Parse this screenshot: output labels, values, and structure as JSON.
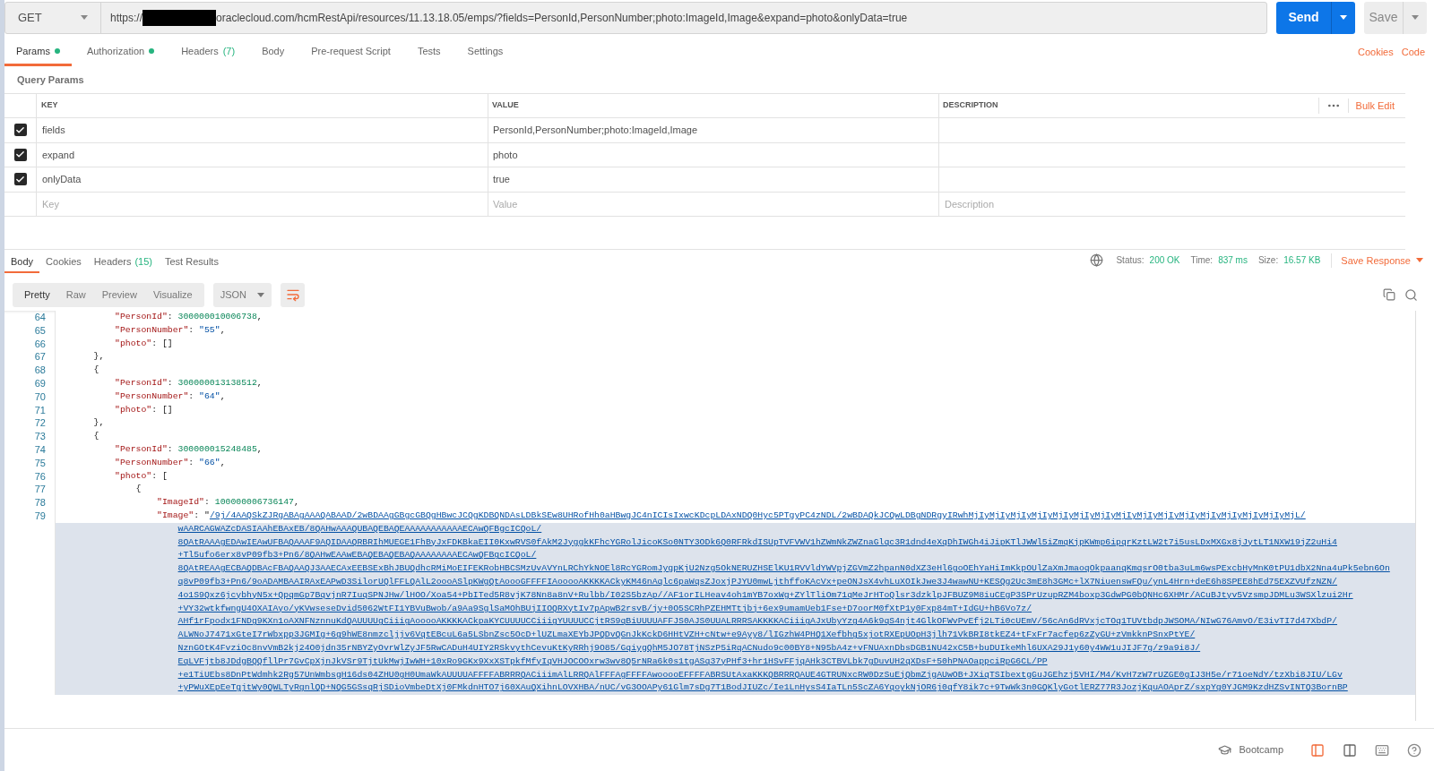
{
  "request": {
    "method": "GET",
    "url_start": "https://",
    "url_end": "oraclecloud.com/hcmRestApi/resources/11.13.18.05/emps/?fields=PersonId,PersonNumber;photo:ImageId,Image&expand=photo&onlyData=true",
    "send": "Send",
    "save": "Save"
  },
  "request_tabs": [
    {
      "label": "Params",
      "dot": true,
      "selected": true
    },
    {
      "label": "Authorization",
      "dot": true,
      "selected": false
    },
    {
      "label": "Headers",
      "count": "(7)",
      "dot": false,
      "selected": false
    },
    {
      "label": "Body",
      "dot": false,
      "selected": false
    },
    {
      "label": "Pre-request Script",
      "dot": false,
      "selected": false
    },
    {
      "label": "Tests",
      "dot": false,
      "selected": false
    },
    {
      "label": "Settings",
      "dot": false,
      "selected": false
    }
  ],
  "request_links": [
    "Cookies",
    "Code"
  ],
  "params": {
    "title": "Query Params",
    "columns": [
      "KEY",
      "VALUE",
      "DESCRIPTION"
    ],
    "bulk_edit": "Bulk Edit",
    "rows": [
      {
        "key": "fields",
        "value": "PersonId,PersonNumber;photo:ImageId,Image",
        "checked": true
      },
      {
        "key": "expand",
        "value": "photo",
        "checked": true
      },
      {
        "key": "onlyData",
        "value": "true",
        "checked": true
      }
    ],
    "new_row": {
      "key_placeholder": "Key",
      "value_placeholder": "Value",
      "description_placeholder": "Description"
    }
  },
  "response_tabs": [
    {
      "label": "Body",
      "selected": true
    },
    {
      "label": "Cookies",
      "selected": false
    },
    {
      "label": "Headers",
      "count": "(15)",
      "selected": false
    },
    {
      "label": "Test Results",
      "selected": false
    }
  ],
  "status": {
    "status_label": "Status:",
    "status": "200 OK",
    "time_label": "Time:",
    "time": "837 ms",
    "size_label": "Size:",
    "size": "16.57 KB",
    "save_response": "Save Response"
  },
  "view_modes": [
    {
      "label": "Pretty",
      "selected": true
    },
    {
      "label": "Raw",
      "selected": false
    },
    {
      "label": "Preview",
      "selected": false
    },
    {
      "label": "Visualize",
      "selected": false
    }
  ],
  "format": "JSON",
  "wrap_lines": true,
  "code_lines": [
    {
      "children": [
        {
          "number": "64",
          "selected": false,
          "tokens": [
            {
              "kind": "key",
              "text": "\"PersonId\""
            },
            {
              "kind": "punct",
              "text": ": "
            },
            {
              "kind": "number",
              "text": "300000010006738"
            },
            {
              "kind": "punct",
              "text": ","
            }
          ]
        },
        {
          "number": "65",
          "selected": false,
          "tokens": [
            {
              "kind": "key",
              "text": "\"PersonNumber\""
            },
            {
              "kind": "punct",
              "text": ": "
            },
            {
              "kind": "string",
              "text": "\"55\""
            },
            {
              "kind": "punct",
              "text": ","
            }
          ]
        },
        {
          "number": "66",
          "selected": false,
          "tokens": [
            {
              "kind": "key",
              "text": "\"photo\""
            },
            {
              "kind": "punct",
              "text": ": []"
            }
          ]
        }
      ]
    },
    {
      "number": "67",
      "selected": false,
      "tokens": [
        {
          "kind": "punct",
          "text": "},"
        }
      ]
    },
    {
      "number": "68",
      "selected": false,
      "tokens": [
        {
          "kind": "punct",
          "text": "{"
        }
      ],
      "children": [
        {
          "number": "69",
          "selected": false,
          "tokens": [
            {
              "kind": "key",
              "text": "\"PersonId\""
            },
            {
              "kind": "punct",
              "text": ": "
            },
            {
              "kind": "number",
              "text": "300000013138512"
            },
            {
              "kind": "punct",
              "text": ","
            }
          ]
        },
        {
          "number": "70",
          "selected": false,
          "tokens": [
            {
              "kind": "key",
              "text": "\"PersonNumber\""
            },
            {
              "kind": "punct",
              "text": ": "
            },
            {
              "kind": "string",
              "text": "\"64\""
            },
            {
              "kind": "punct",
              "text": ","
            }
          ]
        },
        {
          "number": "71",
          "selected": false,
          "tokens": [
            {
              "kind": "key",
              "text": "\"photo\""
            },
            {
              "kind": "punct",
              "text": ": []"
            }
          ]
        }
      ]
    },
    {
      "number": "72",
      "selected": false,
      "tokens": [
        {
          "kind": "punct",
          "text": "},"
        }
      ]
    },
    {
      "number": "73",
      "selected": false,
      "tokens": [
        {
          "kind": "punct",
          "text": "{"
        }
      ],
      "children": [
        {
          "number": "74",
          "selected": false,
          "tokens": [
            {
              "kind": "key",
              "text": "\"PersonId\""
            },
            {
              "kind": "punct",
              "text": ": "
            },
            {
              "kind": "number",
              "text": "300000015248485"
            },
            {
              "kind": "punct",
              "text": ","
            }
          ]
        },
        {
          "number": "75",
          "selected": false,
          "tokens": [
            {
              "kind": "key",
              "text": "\"PersonNumber\""
            },
            {
              "kind": "punct",
              "text": ": "
            },
            {
              "kind": "string",
              "text": "\"66\""
            },
            {
              "kind": "punct",
              "text": ","
            }
          ]
        },
        {
          "number": "76",
          "selected": false,
          "tokens": [
            {
              "kind": "key",
              "text": "\"photo\""
            },
            {
              "kind": "punct",
              "text": ": ["
            }
          ],
          "children": [
            {
              "number": "77",
              "selected": false,
              "tokens": [
                {
                  "kind": "punct",
                  "text": "{"
                }
              ],
              "children": [
                {
                  "number": "78",
                  "selected": false,
                  "tokens": [
                    {
                      "kind": "key",
                      "text": "\"ImageId\""
                    },
                    {
                      "kind": "punct",
                      "text": ": "
                    },
                    {
                      "kind": "number",
                      "text": "100000006736147"
                    },
                    {
                      "kind": "punct",
                      "text": ","
                    }
                  ]
                },
                {
                  "number": "79",
                  "selected": false,
                  "tokens": [
                    {
                      "kind": "key",
                      "text": "\"Image\""
                    },
                    {
                      "kind": "punct",
                      "text": ": \""
                    },
                    {
                      "kind": "link",
                      "text": "/9j/4AAQSkZJRgABAgAAAQABAAD/2wBDAAgGBgcGBQgHBwcJCQgKDBQNDAsLDBkSEw8UHRofHh0aHBwgJC4nICIsIxwcKDcpLDAxNDQ0Hyc5PTgyPC4zNDL/2wBDAQkJCQwLDBgNDRgyIRwhMjIyMjIyMjIyMjIyMjIyMjIyMjIyMjIyMjIyMjIyMjIyMjIyMjIyMjIyMjIyMjL/"
                    }
                  ],
                  "children": [
                    {
                      "selected": true,
                      "tokens": [
                        {
                          "kind": "link",
                          "text": "wAARCAGWAZcDASIAAhEBAxEB/8QAHwAAAQUBAQEBAQEAAAAAAAAAAAECAwQFBgcICQoL/"
                        }
                      ]
                    },
                    {
                      "selected": true,
                      "tokens": [
                        {
                          "kind": "link",
                          "text": "8QAtRAAAgEDAwIEAwUFBAQAAAF9AQIDAAQRBRIhMUEGE1FhByJxFDKBkaEII0KxwRVS0fAkM2JyggkKFhcYGRolJicoKSo0NTY3ODk6Q0RFRkdISUpTVFVWV1hZWmNkZWZnaGlqc3R1dnd4eXqDhIWGh4iJipKTlJWWl5iZmqKjpKWmp6ipqrKztLW2t7i5usLDxMXGx8jJytLT1NXW19jZ2uHi4"
                        }
                      ]
                    },
                    {
                      "selected": true,
                      "tokens": [
                        {
                          "kind": "link",
                          "text": "+Tl5ufo6erx8vP09fb3+Pn6/8QAHwEAAwEBAQEBAQEBAQAAAAAAAAECAwQFBgcICQoL/"
                        }
                      ]
                    },
                    {
                      "selected": true,
                      "tokens": [
                        {
                          "kind": "link",
                          "text": "8QAtREAAgECBAQDBAcFBAQAAQJ3AAECAxEEBSExBhJBUQdhcRMiMoEIFEKRobHBCSMzUvAVYnLRChYkNOEl8RcYGRomJygpKjU2Nzg5OkNERUZHSElKU1RVVldYWVpjZGVmZ2hpanN0dXZ3eHl6goOEhYaHiImKkpOUlZaXmJmaoqOkpaanqKmqsrO0tba3uLm6wsPExcbHyMnK0tPU1dbX2Nna4uPk5ebn6On"
                        }
                      ]
                    },
                    {
                      "selected": true,
                      "tokens": [
                        {
                          "kind": "link",
                          "text": "q8vP09fb3+Pn6/9oADAMBAAIRAxEAPwD3SilorUQlFFLQAlL2oooASlpKWgQtAoooGFFFFIAooooAKKKKACkyKM46nAqlc6paWqsZJoxjPJYU0mwLjthffoKAcVx+peONJsX4vhLuXOIkJwe3J4wawNU+KESQg2Uc3mE8h3GMc+lX7NiuenswFQu/ynL4Hrn+deE6h8SPEE8hEd75EXZVUfzNZN/"
                        }
                      ]
                    },
                    {
                      "selected": true,
                      "tokens": [
                        {
                          "kind": "link",
                          "text": "4o1S9Qxz6jcybhyN5x+QpqmGp7BqvjnR7IuqSPNJHw/lHOO/Xoa54+PbITed5R8vjK78Nn8a8nV+Rulbb/I02S5bzAp//AF1orILHeav4oh1mYB7oxWg+ZYlTliOm71qMeJrHToQlsr3dzklpJFBUZ9M8iuCEgP3SPrUzupRZM4boxp3GdwPG0bQNHc6XHMr/ACuBJtyv5VzsmpJDMLu3WSXlzui2Hr"
                        }
                      ]
                    },
                    {
                      "selected": true,
                      "tokens": [
                        {
                          "kind": "link",
                          "text": "+VY32wtkfwngU4OXAIAyo/yKVwseseDvid5062WtFI1YBVuBwob/a9Aa9SglSaMOhBUjIIOQRXytIv7pApwB2rsvB/jy+0O5SCRhPZEHMTtjbj+6ex9umamUeb1Fse+D7oorM0fXtP1y0Fxp84mT+IdGU+hB6Vo7z/"
                        }
                      ]
                    },
                    {
                      "selected": true,
                      "tokens": [
                        {
                          "kind": "link",
                          "text": "AHf1rFpodx1FNDg9KXn1oAXNFNznnuKdQAUUUUgCiiigAooooAKKKKACkpaKYCUUUUCCiiigYUUUUCCjtRS9qBiUUUUAFFJS0AJS0UUALRRRSAKKKKACiiigAJxUbyYzg4A6k9qS4njt4GlkOFWvPvEfj2LTi0cUEmV/56cAn6dRVxjcTOq1TUVtbdpJWSOMA/NIwG76AmvO/E3ivTI7d47XbdP/"
                        }
                      ]
                    },
                    {
                      "selected": true,
                      "tokens": [
                        {
                          "kind": "link",
                          "text": "ALWNoJ7471xGteI7rWbxpp3JGMIg+6g9hWE8nmzcljjv6VqtEBcuL6a5LSbnZsc5OcD+lUZLmaXEYbJPQDvQGnJkKckD6HHtVZH+cNtw+e9Ayy8/lIGzhW4PHQ1Xefbhg5xjotRXEpUOpH3jlh71VkBRI8tkEZ4+tFxFr7acfep6zZyGU+zVmkknPSnxPtYE/"
                        }
                      ]
                    },
                    {
                      "selected": true,
                      "tokens": [
                        {
                          "kind": "link",
                          "text": "NznGOtK4FvziOc8nvVmB2kj24O0jdn35rNBYZyOvrWlZyJF5RwCADuH4UIY2RSkvythCevuKtKyRRhj9O85/GqiygQhM5JO78TjNSzP5iRqACNudo9c00BY8+N95bA4z+vFNUAxnDbsDGB1NU42xC5B+buDUIkeMhl6UXA29J1y60y4WW1uJIJF7g/z9a9i8J/"
                        }
                      ]
                    },
                    {
                      "selected": true,
                      "tokens": [
                        {
                          "kind": "link",
                          "text": "EqLVFjtb8JDdgBQQfllPr7GvCpXjnJkVSr9TjtUkMwjIwWH+10xRo9GKx9XxXSTpkfMfyIqVHJOCOOxrw3wv8Q5rNRa6k0s1tgASq37yPHf3+hr1HSvFFjqAHk3CTBVLbk7gDuvUH2qXDsF+50hPNAOappciRpG6CL/PP"
                        }
                      ]
                    },
                    {
                      "selected": true,
                      "tokens": [
                        {
                          "kind": "link",
                          "text": "+e1TiUEbs8DnPtWdmhk2Rg57UnWmbsgH16ds04ZHU0gH0UmaWkAUUUUAFFFFABRRRQACiiimAlLRRQAlFFFAgFFFFAwooooEFFFFABRSUtAxaKKKQBRRRQAUE4GTRUNxcRW0DzSuEjQbmZjgAUwOB+JXiqTSIbextgGuJGEhzj5VHI/M4/KvH7zW7rUZGE0gIJ3H5e/r71oeNdY/tzXbi8JIU/LGv"
                        }
                      ]
                    },
                    {
                      "selected": true,
                      "tokens": [
                        {
                          "kind": "link",
                          "text": "+yPWuXEpEeTgjtWy0QWLTyRgnlQD+NQG5GSsqRjSDioVmbeDtXj0FMkdnHTO7j60XAuQXihnLOVXHBA/nUC/vG3OOAPy61Glm7sDg7T1BodJIUZc/Ie1LnHysS4IaTLn5ScZA6YqoykNjOR6j0qfY8ik7c+9TwWk3n0GQKlyGotlERZ77R3JozjKquAOAprZ/sxpYg0YJGM9KzdHZSvINTQ3BornBP"
                        }
                      ]
                    }
                  ]
                }
              ]
            }
          ]
        }
      ]
    }
  ],
  "footer": {
    "bootcamp": "Bootcamp"
  }
}
